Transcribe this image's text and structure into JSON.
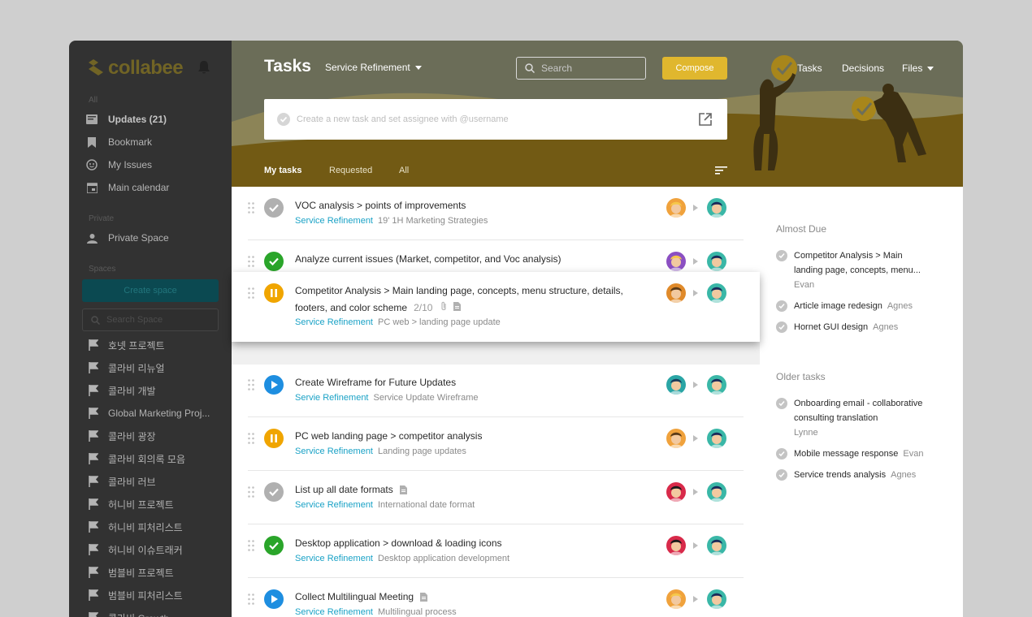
{
  "app": {
    "logo": "collabee"
  },
  "sidebar": {
    "section_all": "All",
    "items": [
      {
        "label": "Updates (21)",
        "icon": "updates-icon",
        "active": true
      },
      {
        "label": "Bookmark",
        "icon": "bookmark-icon"
      },
      {
        "label": "My Issues",
        "icon": "smiley-icon"
      },
      {
        "label": "Main calendar",
        "icon": "calendar-icon"
      }
    ],
    "section_private": "Private",
    "private_space": "Private Space",
    "section_spaces": "Spaces",
    "create_space": "Create space",
    "search_space_placeholder": "Search Space",
    "spaces": [
      "호넷 프로젝트",
      "콜라비 리뉴얼",
      "콜라비 개발",
      "Global Marketing Proj...",
      "콜라비 광장",
      "콜라비 회의록 모음",
      "콜라비 러브",
      "허니비 프로젝트",
      "허니비 피처리스트",
      "허니비 이슈트래커",
      "범블비 프로젝트",
      "범블비 피처리스트",
      "콜라비 Growth"
    ]
  },
  "header": {
    "title": "Tasks",
    "space_selector": "Service Refinement",
    "search_placeholder": "Search",
    "compose": "Compose",
    "nav": {
      "tasks": "Tasks",
      "decisions": "Decisions",
      "files": "Files"
    },
    "new_task_placeholder": "Create a new task and set assignee with @username",
    "tabs": {
      "my": "My tasks",
      "requested": "Requested",
      "all": "All"
    }
  },
  "tasks": [
    {
      "title": "VOC analysis > points of improvements",
      "space": "Service Refinement",
      "project": "19' 1H Marketing Strategies",
      "status": "done-grey"
    },
    {
      "title": "Analyze current issues (Market, competitor, and Voc analysis)",
      "space": "",
      "project": "",
      "status": "done-green"
    },
    {
      "title": "Competitor Analysis > Main landing page, concepts, menu structure, details,",
      "title2": "footers, and color scheme",
      "count": "2/10",
      "space": "Service Refinement",
      "project": "PC web > landing page update",
      "status": "pause"
    },
    {
      "title": "Create Wireframe for Future Updates",
      "space": "Servie Refinement",
      "project": "Service Update Wireframe",
      "status": "play"
    },
    {
      "title": "PC web landing page > competitor analysis",
      "space": "Service Refinement",
      "project": "Landing page updates",
      "status": "pause"
    },
    {
      "title": "List up all date formats",
      "space": "Service Refinement",
      "project": "International date format",
      "status": "done-grey"
    },
    {
      "title": "Desktop application > download & loading icons",
      "space": "Service Refinement",
      "project": "Desktop application development",
      "status": "done-green"
    },
    {
      "title": "Collect Multilingual Meeting",
      "space": "Service Refinement",
      "project": "Multilingual process",
      "status": "play"
    }
  ],
  "right_panel": {
    "almost_due": "Almost Due",
    "almost_due_items": [
      {
        "line1": "Competitor Analysis > Main",
        "line2": "landing page, concepts, menu...",
        "who": "Evan"
      },
      {
        "line1": "Article image redesign",
        "who": "Agnes"
      },
      {
        "line1": "Hornet GUI design",
        "who": "Agnes"
      }
    ],
    "older": "Older tasks",
    "older_items": [
      {
        "line1": "Onboarding email - collaborative",
        "line2": "consulting translation",
        "who": "Lynne"
      },
      {
        "line1": "Mobile message response",
        "who": "Evan"
      },
      {
        "line1": "Service trends analysis",
        "who": "Agnes"
      }
    ]
  },
  "colors": {
    "accent": "#e0b72e",
    "sidebar": "#3d3d3d",
    "hero": "#6d6f5a",
    "link": "#1aa2c6"
  }
}
